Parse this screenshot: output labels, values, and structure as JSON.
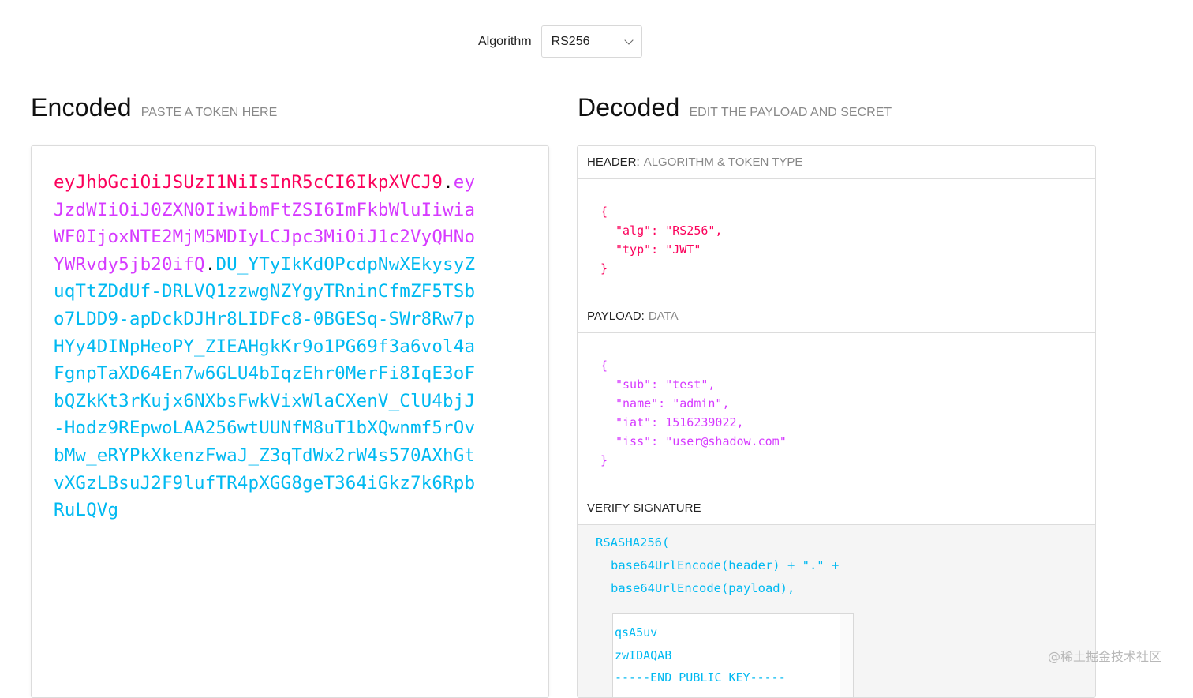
{
  "algorithm": {
    "label": "Algorithm",
    "value": "RS256"
  },
  "encoded": {
    "title": "Encoded",
    "subtitle": "PASTE A TOKEN HERE",
    "token": {
      "header": "eyJhbGciOiJSUzI1NiIsInR5cCI6IkpXVCJ9",
      "payload": "eyJzdWIiOiJ0ZXN0IiwibmFtZSI6ImFkbWluIiwiaWF0IjoxNTE2MjM5MDIyLCJpc3MiOiJ1c2VyQHNoYWRvdy5jb20ifQ",
      "signature": "DU_YTyIkKdOPcdpNwXEkysyZuqTtZDdUf-DRLVQ1zzwgNZYgyTRninCfmZF5TSbo7LDD9-apDckDJHr8LIDFc8-0BGESq-SWr8Rw7pHYy4DINpHeoPY_ZIEAHgkKr9o1PG69f3a6vol4aFgnpTaXD64En7w6GLU4bIqzEhr0MerFi8IqE3oFbQZkKt3rKujx6NXbsFwkVixWlaCXenV_ClU4bjJ-Hodz9REpwoLAA256wtUUNfM8uT1bXQwnmf5rOvbMw_eRYPkXkenzFwaJ_Z3qTdWx2rW4s570AXhGtvXGzLBsuJ2F9lufTR4pXGG8geT364iGkz7k6RpbRuLQVg",
      "dot": "."
    }
  },
  "decoded": {
    "title": "Decoded",
    "subtitle": "EDIT THE PAYLOAD AND SECRET",
    "header_section": {
      "label": "HEADER:",
      "sublabel": "ALGORITHM & TOKEN TYPE",
      "open": "{",
      "lines": [
        "\"alg\": \"RS256\",",
        "\"typ\": \"JWT\""
      ],
      "close": "}"
    },
    "payload_section": {
      "label": "PAYLOAD:",
      "sublabel": "DATA",
      "open": "{",
      "lines": [
        "\"sub\": \"test\",",
        "\"name\": \"admin\",",
        "\"iat\": 1516239022,",
        "\"iss\": \"user@shadow.com\""
      ],
      "close": "}"
    },
    "verify_section": {
      "label": "VERIFY SIGNATURE",
      "fn": "RSASHA256(",
      "arg1": "base64UrlEncode(header) + \".\" +",
      "arg2": "base64UrlEncode(payload),",
      "key_lines": [
        "qsA5uv",
        "zwIDAQAB",
        "-----END PUBLIC KEY-----"
      ]
    }
  },
  "watermark": "@稀土掘金技术社区",
  "colors": {
    "header": "#fb015b",
    "payload": "#d63aff",
    "signature": "#00b9f1"
  }
}
